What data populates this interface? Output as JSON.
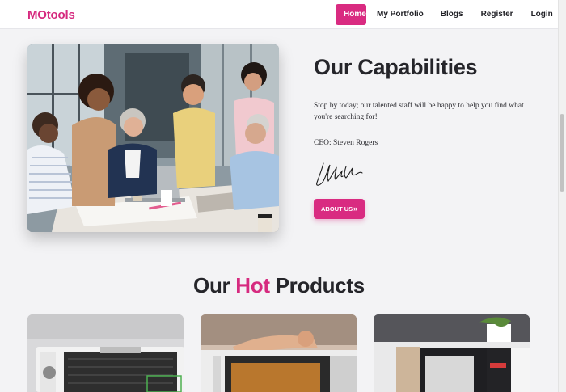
{
  "brand": "MOtools",
  "nav": {
    "items": [
      {
        "label": "Home"
      },
      {
        "label": "My Portfolio"
      },
      {
        "label": "Blogs"
      },
      {
        "label": "Register"
      },
      {
        "label": "Login"
      }
    ]
  },
  "capabilities": {
    "title": "Our Capabilities",
    "description": "Stop by today; our talented staff will be happy to help you find what you're searching for!",
    "ceo": "CEO: Steven Rogers",
    "button_label": "ABOUT US",
    "button_icon": "double-chevron-right-icon"
  },
  "products": {
    "title_part1": "Our ",
    "title_highlight": "Hot",
    "title_part2": " Products"
  },
  "colors": {
    "accent": "#d92b81",
    "heading": "#25252a",
    "background": "#f3f3f5"
  }
}
